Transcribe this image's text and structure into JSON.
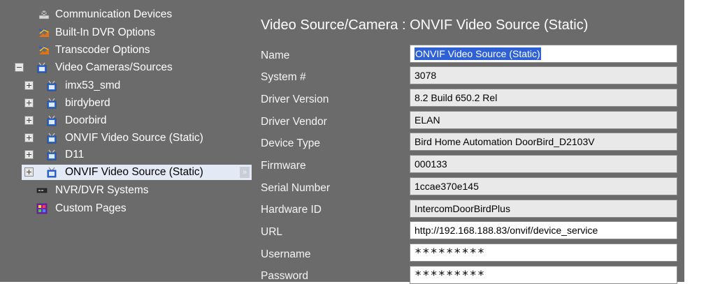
{
  "sidebar": {
    "items": [
      {
        "label": "Communication Devices",
        "icon": "communication-devices-icon"
      },
      {
        "label": "Built-In DVR Options",
        "icon": "dvr-options-icon"
      },
      {
        "label": "Transcoder Options",
        "icon": "transcoder-options-icon"
      },
      {
        "label": "Video Cameras/Sources",
        "icon": "video-camera-icon",
        "expander": "minus"
      },
      {
        "label": "imx53_smd",
        "icon": "video-camera-icon",
        "expander": "plus"
      },
      {
        "label": "birdyberd",
        "icon": "video-camera-icon",
        "expander": "plus"
      },
      {
        "label": "Doorbird",
        "icon": "video-camera-icon",
        "expander": "plus"
      },
      {
        "label": "ONVIF Video Source (Static)",
        "icon": "video-camera-icon",
        "expander": "plus"
      },
      {
        "label": "D11",
        "icon": "video-camera-icon",
        "expander": "plus"
      },
      {
        "label": "ONVIF Video Source (Static)",
        "icon": "video-camera-icon",
        "expander": "plus",
        "selected": true
      },
      {
        "label": "NVR/DVR Systems",
        "icon": "nvr-dvr-icon"
      },
      {
        "label": "Custom Pages",
        "icon": "custom-pages-icon"
      }
    ]
  },
  "main": {
    "title": "Video Source/Camera : ONVIF Video Source (Static)",
    "fields": {
      "name": {
        "label": "Name",
        "value": "ONVIF Video Source (Static)"
      },
      "system_num": {
        "label": "System #",
        "value": "3078"
      },
      "driver_version": {
        "label": "Driver Version",
        "value": "8.2 Build 650.2 Rel"
      },
      "driver_vendor": {
        "label": "Driver Vendor",
        "value": "ELAN"
      },
      "device_type": {
        "label": "Device Type",
        "value": "Bird Home Automation DoorBird_D2103V"
      },
      "firmware": {
        "label": "Firmware",
        "value": "000133"
      },
      "serial_number": {
        "label": "Serial Number",
        "value": "1ccae370e145"
      },
      "hardware_id": {
        "label": "Hardware ID",
        "value": "IntercomDoorBirdPlus"
      },
      "url": {
        "label": "URL",
        "value": "http://192.168.188.83/onvif/device_service"
      },
      "username": {
        "label": "Username",
        "value": "*********"
      },
      "password": {
        "label": "Password",
        "value": "*********"
      }
    }
  },
  "colors": {
    "panel_bg": "#6b6b6b",
    "selected_row_bg": "#e4e9f6",
    "text_selection": "#2e61d6"
  }
}
